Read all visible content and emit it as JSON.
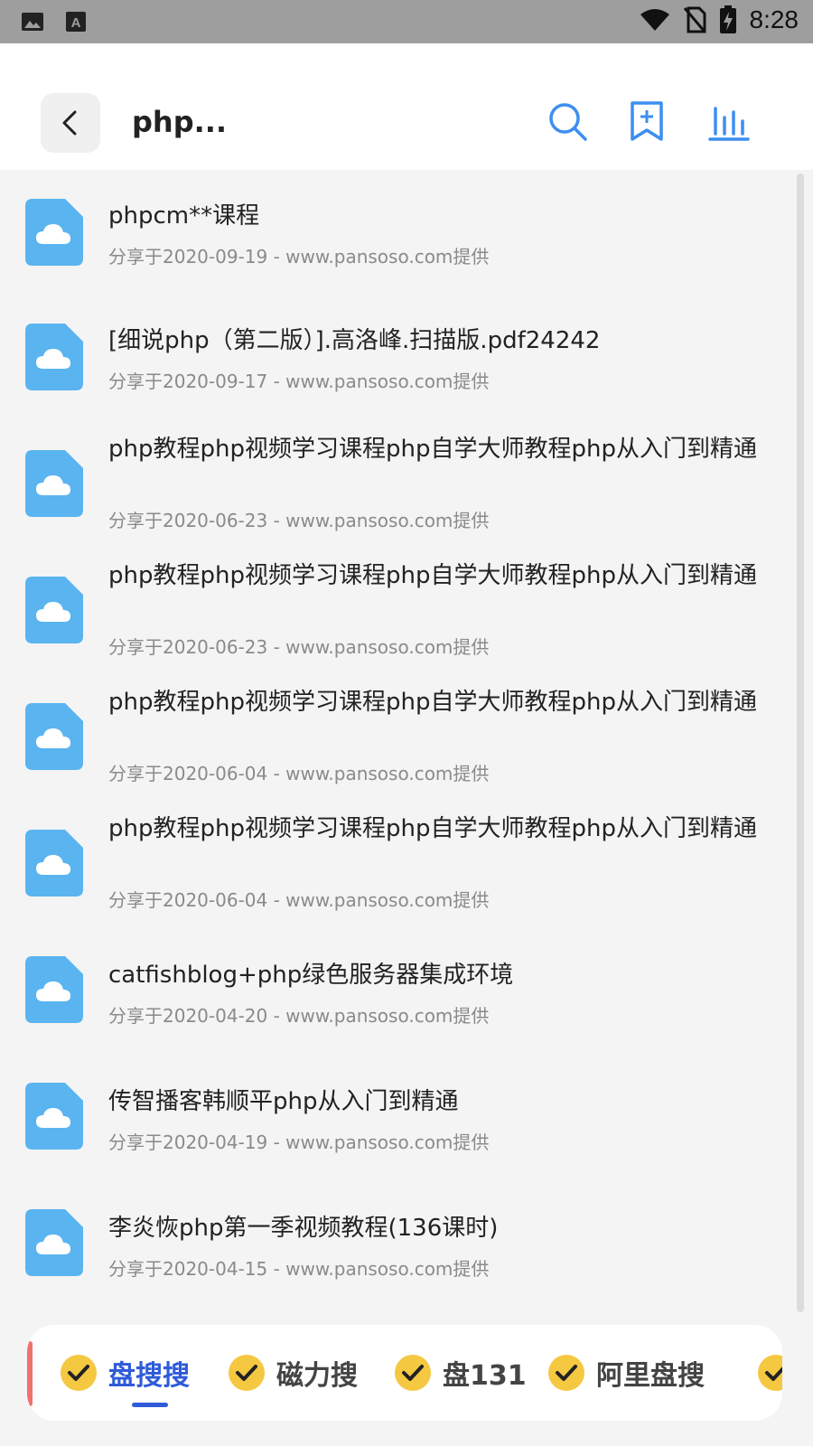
{
  "status_bar": {
    "time": "8:28"
  },
  "header": {
    "title": "php..."
  },
  "results": [
    {
      "title": "phpcm**课程",
      "meta": "分享于2020-09-19 - www.pansoso.com提供"
    },
    {
      "title": "[细说php（第二版）].高洛峰.扫描版.pdf24242",
      "meta": "分享于2020-09-17 - www.pansoso.com提供"
    },
    {
      "title": "php教程php视频学习课程php自学大师教程php从入门到精通",
      "meta": "分享于2020-06-23 - www.pansoso.com提供"
    },
    {
      "title": "php教程php视频学习课程php自学大师教程php从入门到精通",
      "meta": "分享于2020-06-23 - www.pansoso.com提供"
    },
    {
      "title": "php教程php视频学习课程php自学大师教程php从入门到精通",
      "meta": "分享于2020-06-04 - www.pansoso.com提供"
    },
    {
      "title": "php教程php视频学习课程php自学大师教程php从入门到精通",
      "meta": "分享于2020-06-04 - www.pansoso.com提供"
    },
    {
      "title": "catfishblog+php绿色服务器集成环境",
      "meta": "分享于2020-04-20 - www.pansoso.com提供"
    },
    {
      "title": "传智播客韩顺平php从入门到精通",
      "meta": "分享于2020-04-19 - www.pansoso.com提供"
    },
    {
      "title": "李炎恢php第一季视频教程(136课时)",
      "meta": "分享于2020-04-15 - www.pansoso.com提供"
    }
  ],
  "tabs": [
    {
      "label": "盘搜搜"
    },
    {
      "label": "磁力搜"
    },
    {
      "label": "盘131"
    },
    {
      "label": "阿里盘搜"
    }
  ],
  "colors": {
    "accent": "#2f5bd9",
    "icon_blue": "#5ab4f0",
    "check_yellow": "#f5c842"
  }
}
